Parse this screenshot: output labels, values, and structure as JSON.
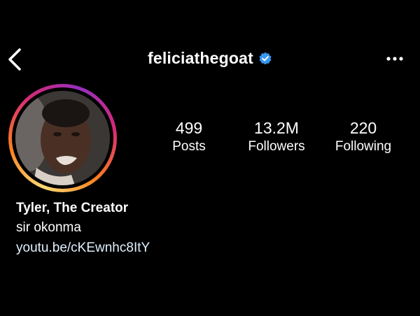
{
  "header": {
    "username": "feliciathegoat",
    "back_icon": "chevron-left-icon",
    "verified_icon": "verified-badge-icon",
    "more_icon": "ellipsis-icon",
    "verified_color": "#3897f0"
  },
  "profile": {
    "avatar_ring_colors": [
      "#feda75",
      "#fa7e1e",
      "#d62976",
      "#962fbf"
    ]
  },
  "stats": [
    {
      "value": "499",
      "label": "Posts"
    },
    {
      "value": "13.2M",
      "label": "Followers"
    },
    {
      "value": "220",
      "label": "Following"
    }
  ],
  "bio": {
    "name": "Tyler, The Creator",
    "text": "sir okonma",
    "link": "youtu.be/cKEwnhc8ItY"
  }
}
